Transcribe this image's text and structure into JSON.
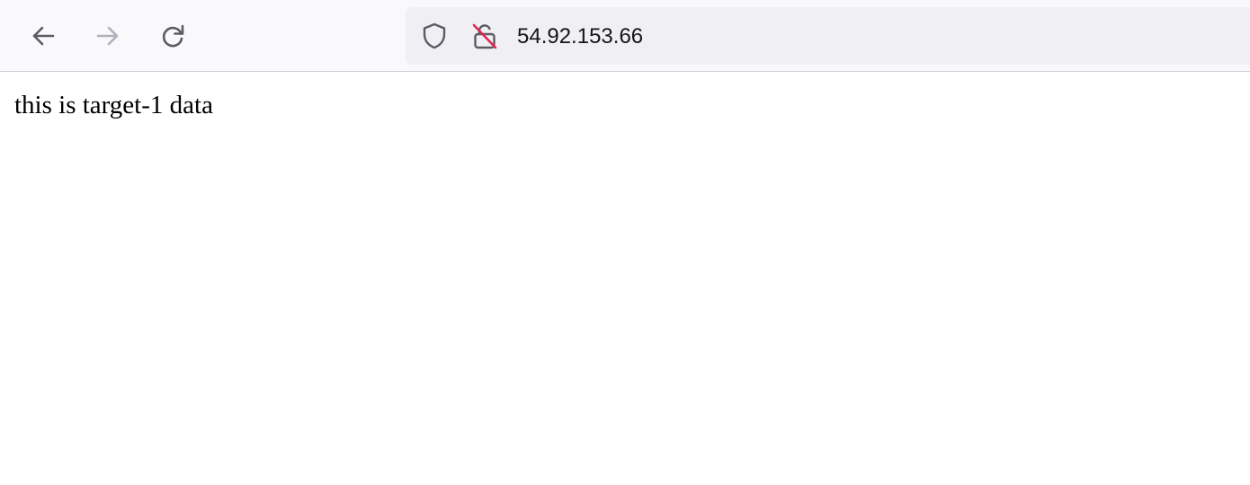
{
  "toolbar": {
    "back_icon": "arrow-left-icon",
    "forward_icon": "arrow-right-icon",
    "reload_icon": "reload-icon",
    "colors": {
      "toolbar_bg": "#f9f9fb",
      "urlbar_bg": "#f0f0f4",
      "icon_active": "#5b5b66",
      "icon_disabled": "#b1b1b9",
      "insecure_strike": "#e22850"
    }
  },
  "urlbar": {
    "tracking_icon": "shield-icon",
    "security_icon": "insecure-lock-icon",
    "url": "54.92.153.66"
  },
  "page": {
    "body_text": "this is target-1 data"
  }
}
